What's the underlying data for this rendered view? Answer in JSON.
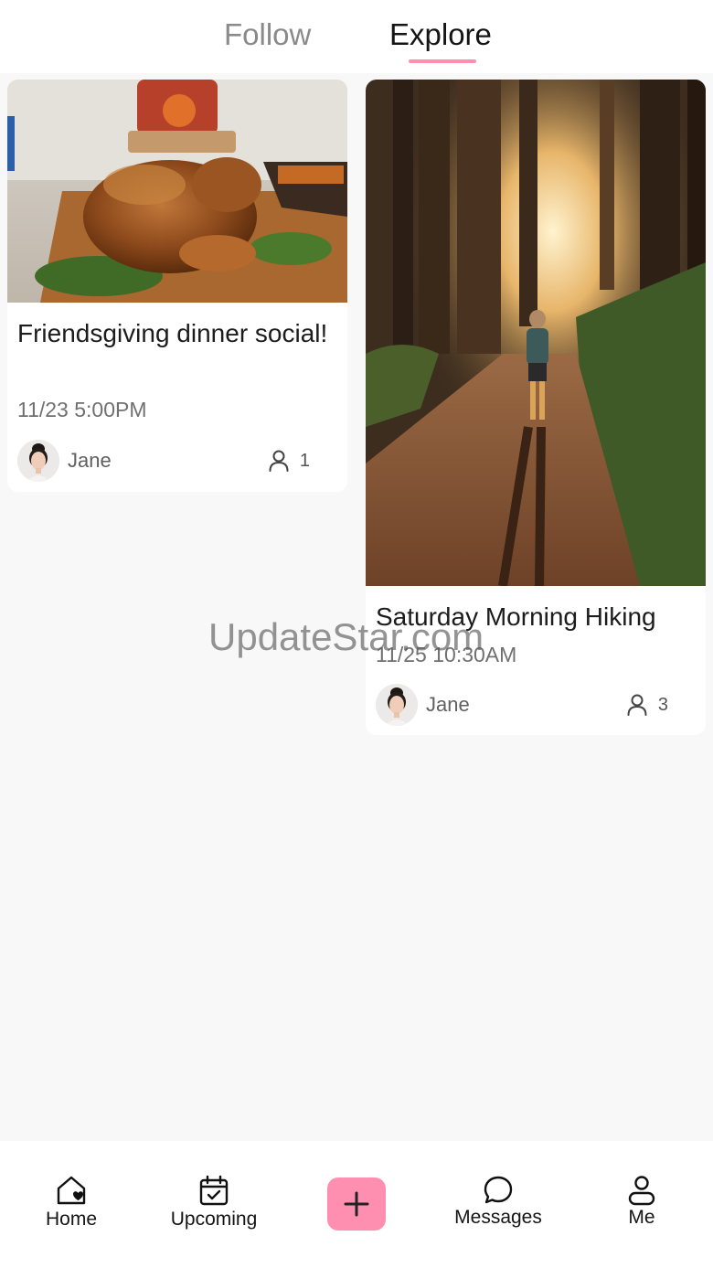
{
  "tabs": {
    "follow": "Follow",
    "explore": "Explore",
    "active": "Explore"
  },
  "accent_color": "#ff8fb1",
  "cards": [
    {
      "title": "Friendsgiving dinner social!",
      "time": "11/23 5:00PM",
      "author": "Jane",
      "participants": "1",
      "image": "roast-turkey-photo"
    },
    {
      "title": "Saturday Morning Hiking",
      "time": "11/25 10:30AM",
      "author": "Jane",
      "participants": "3",
      "image": "forest-trail-hiker-photo"
    }
  ],
  "watermark": "UpdateStar.com",
  "nav": {
    "home": "Home",
    "upcoming": "Upcoming",
    "messages": "Messages",
    "me": "Me"
  },
  "icons": {
    "home": "home-heart-icon",
    "upcoming": "calendar-check-icon",
    "add": "plus-icon",
    "messages": "chat-bubble-icon",
    "me": "person-icon",
    "participants": "person-outline-icon"
  }
}
